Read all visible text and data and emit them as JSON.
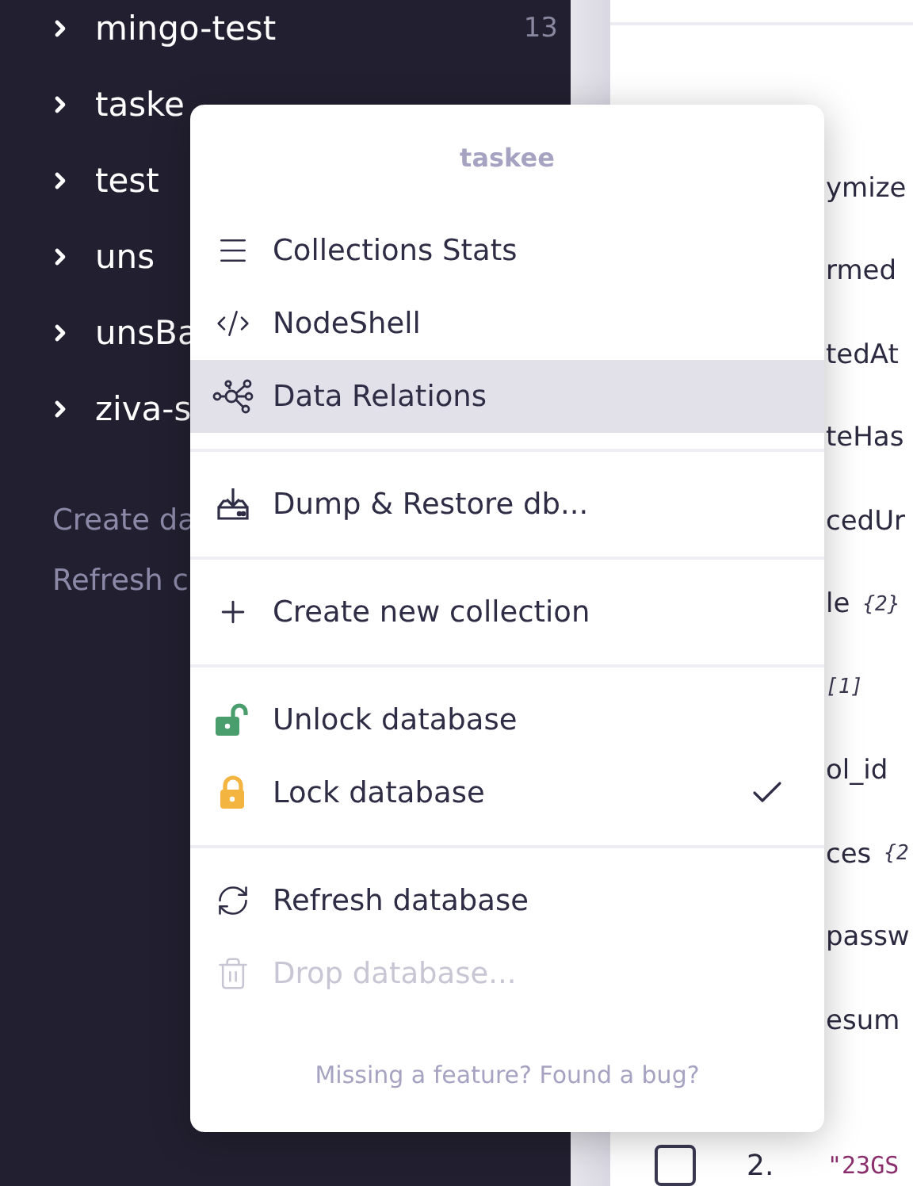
{
  "sidebar": {
    "databases": [
      {
        "name": "mingo-test",
        "count": "13",
        "expanded": false
      },
      {
        "name": "taske",
        "expanded": false
      },
      {
        "name": "test",
        "expanded": false
      },
      {
        "name": "uns",
        "expanded": false
      },
      {
        "name": "unsBa",
        "expanded": false
      },
      {
        "name": "ziva-s",
        "expanded": false
      }
    ],
    "actions": [
      "Create da",
      "Refresh c"
    ]
  },
  "document": {
    "fields": [
      {
        "key": "ymize"
      },
      {
        "key": "rmed"
      },
      {
        "key": "tedAt"
      },
      {
        "key": "teHas"
      },
      {
        "key": "cedUr"
      },
      {
        "key": "le",
        "hint": "{2}"
      },
      {
        "hint": "[1]"
      },
      {
        "key": "ol_id"
      },
      {
        "key": "ces",
        "hint": "{2"
      },
      {
        "key": "passw"
      },
      {
        "key": "esum"
      }
    ],
    "next_row": {
      "checked": false,
      "index": "2.",
      "value": "\"23GS"
    }
  },
  "menu": {
    "title": "taskee",
    "sections": [
      [
        {
          "label": "Collections Stats",
          "selected": false,
          "checked": false,
          "disabled": false
        },
        {
          "label": "NodeShell",
          "selected": false,
          "checked": false,
          "disabled": false
        },
        {
          "label": "Data Relations",
          "selected": true,
          "checked": false,
          "disabled": false
        }
      ],
      [
        {
          "label": "Dump & Restore db...",
          "selected": false,
          "checked": false,
          "disabled": false
        }
      ],
      [
        {
          "label": "Create new collection",
          "selected": false,
          "checked": false,
          "disabled": false
        }
      ],
      [
        {
          "label": "Unlock database",
          "selected": false,
          "checked": false,
          "disabled": false
        },
        {
          "label": "Lock database",
          "selected": false,
          "checked": true,
          "disabled": false
        }
      ],
      [
        {
          "label": "Refresh database",
          "selected": false,
          "checked": false,
          "disabled": false
        },
        {
          "label": "Drop database...",
          "selected": false,
          "checked": false,
          "disabled": true
        }
      ]
    ],
    "footer": "Missing a feature? Found a bug?"
  }
}
